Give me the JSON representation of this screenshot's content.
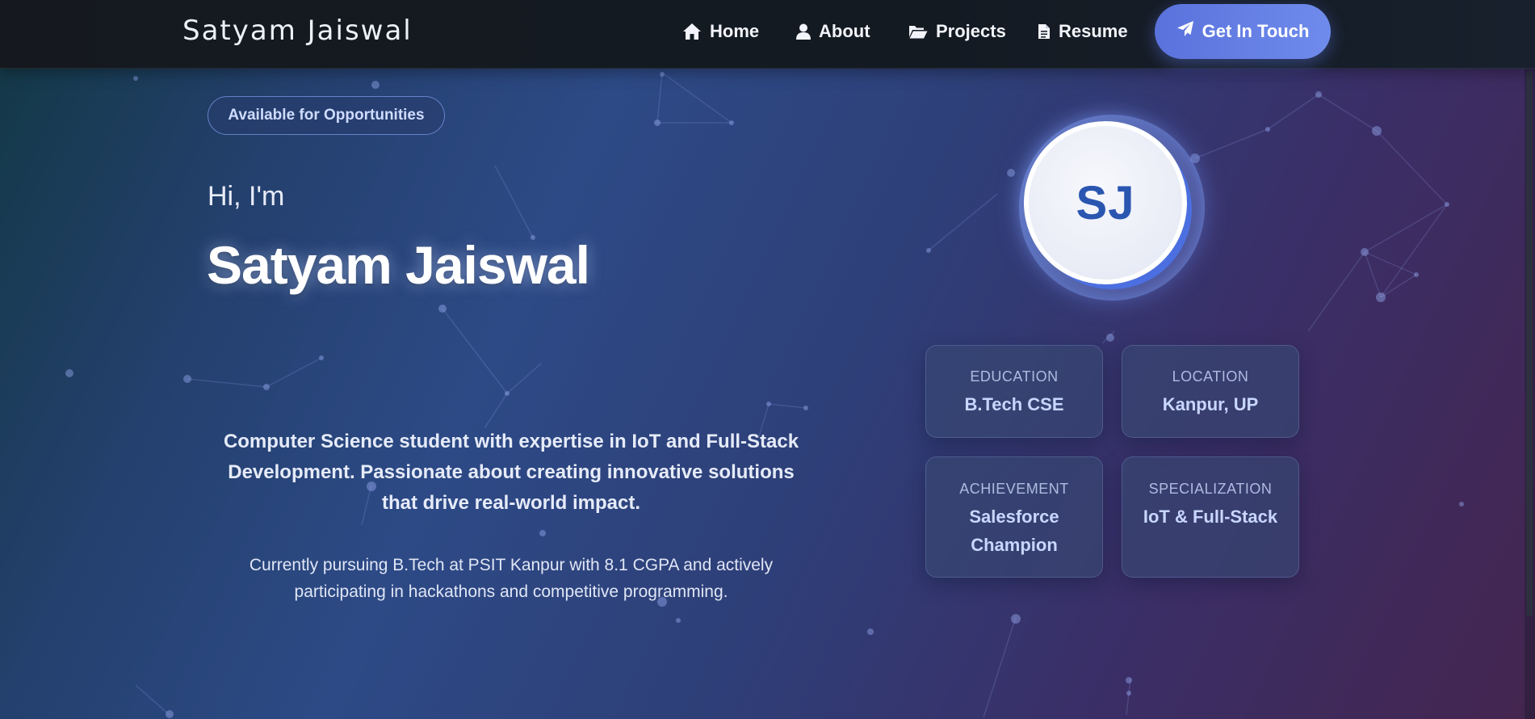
{
  "navbar": {
    "brand": "Satyam Jaiswal",
    "items": [
      {
        "label": "Home",
        "icon": "home-icon"
      },
      {
        "label": "About",
        "icon": "user-icon"
      },
      {
        "label": "Projects",
        "icon": "folder-open-icon"
      },
      {
        "label": "Resume",
        "icon": "file-icon"
      }
    ],
    "cta": {
      "label": "Get In Touch",
      "icon": "paper-plane-icon"
    }
  },
  "hero": {
    "badge": "Available for Opportunities",
    "greeting": "Hi, I'm",
    "name": "Satyam Jaiswal",
    "description": "Computer Science student with expertise in IoT and Full-Stack Development. Passionate about creating innovative solutions that drive real-world impact.",
    "subtext": "Currently pursuing B.Tech at PSIT Kanpur with 8.1 CGPA and actively participating in hackathons and competitive programming."
  },
  "profile": {
    "initials": "SJ",
    "cards": [
      {
        "label": "EDUCATION",
        "value": "B.Tech CSE"
      },
      {
        "label": "LOCATION",
        "value": "Kanpur, UP"
      },
      {
        "label": "ACHIEVEMENT",
        "value": "Salesforce Champion"
      },
      {
        "label": "SPECIALIZATION",
        "value": "IoT & Full-Stack"
      }
    ]
  },
  "colors": {
    "accent": "#5a72dc",
    "navbar_bg": "#15191f",
    "avatar_text": "#2a56b0",
    "card_value": "#c9d6ff"
  }
}
